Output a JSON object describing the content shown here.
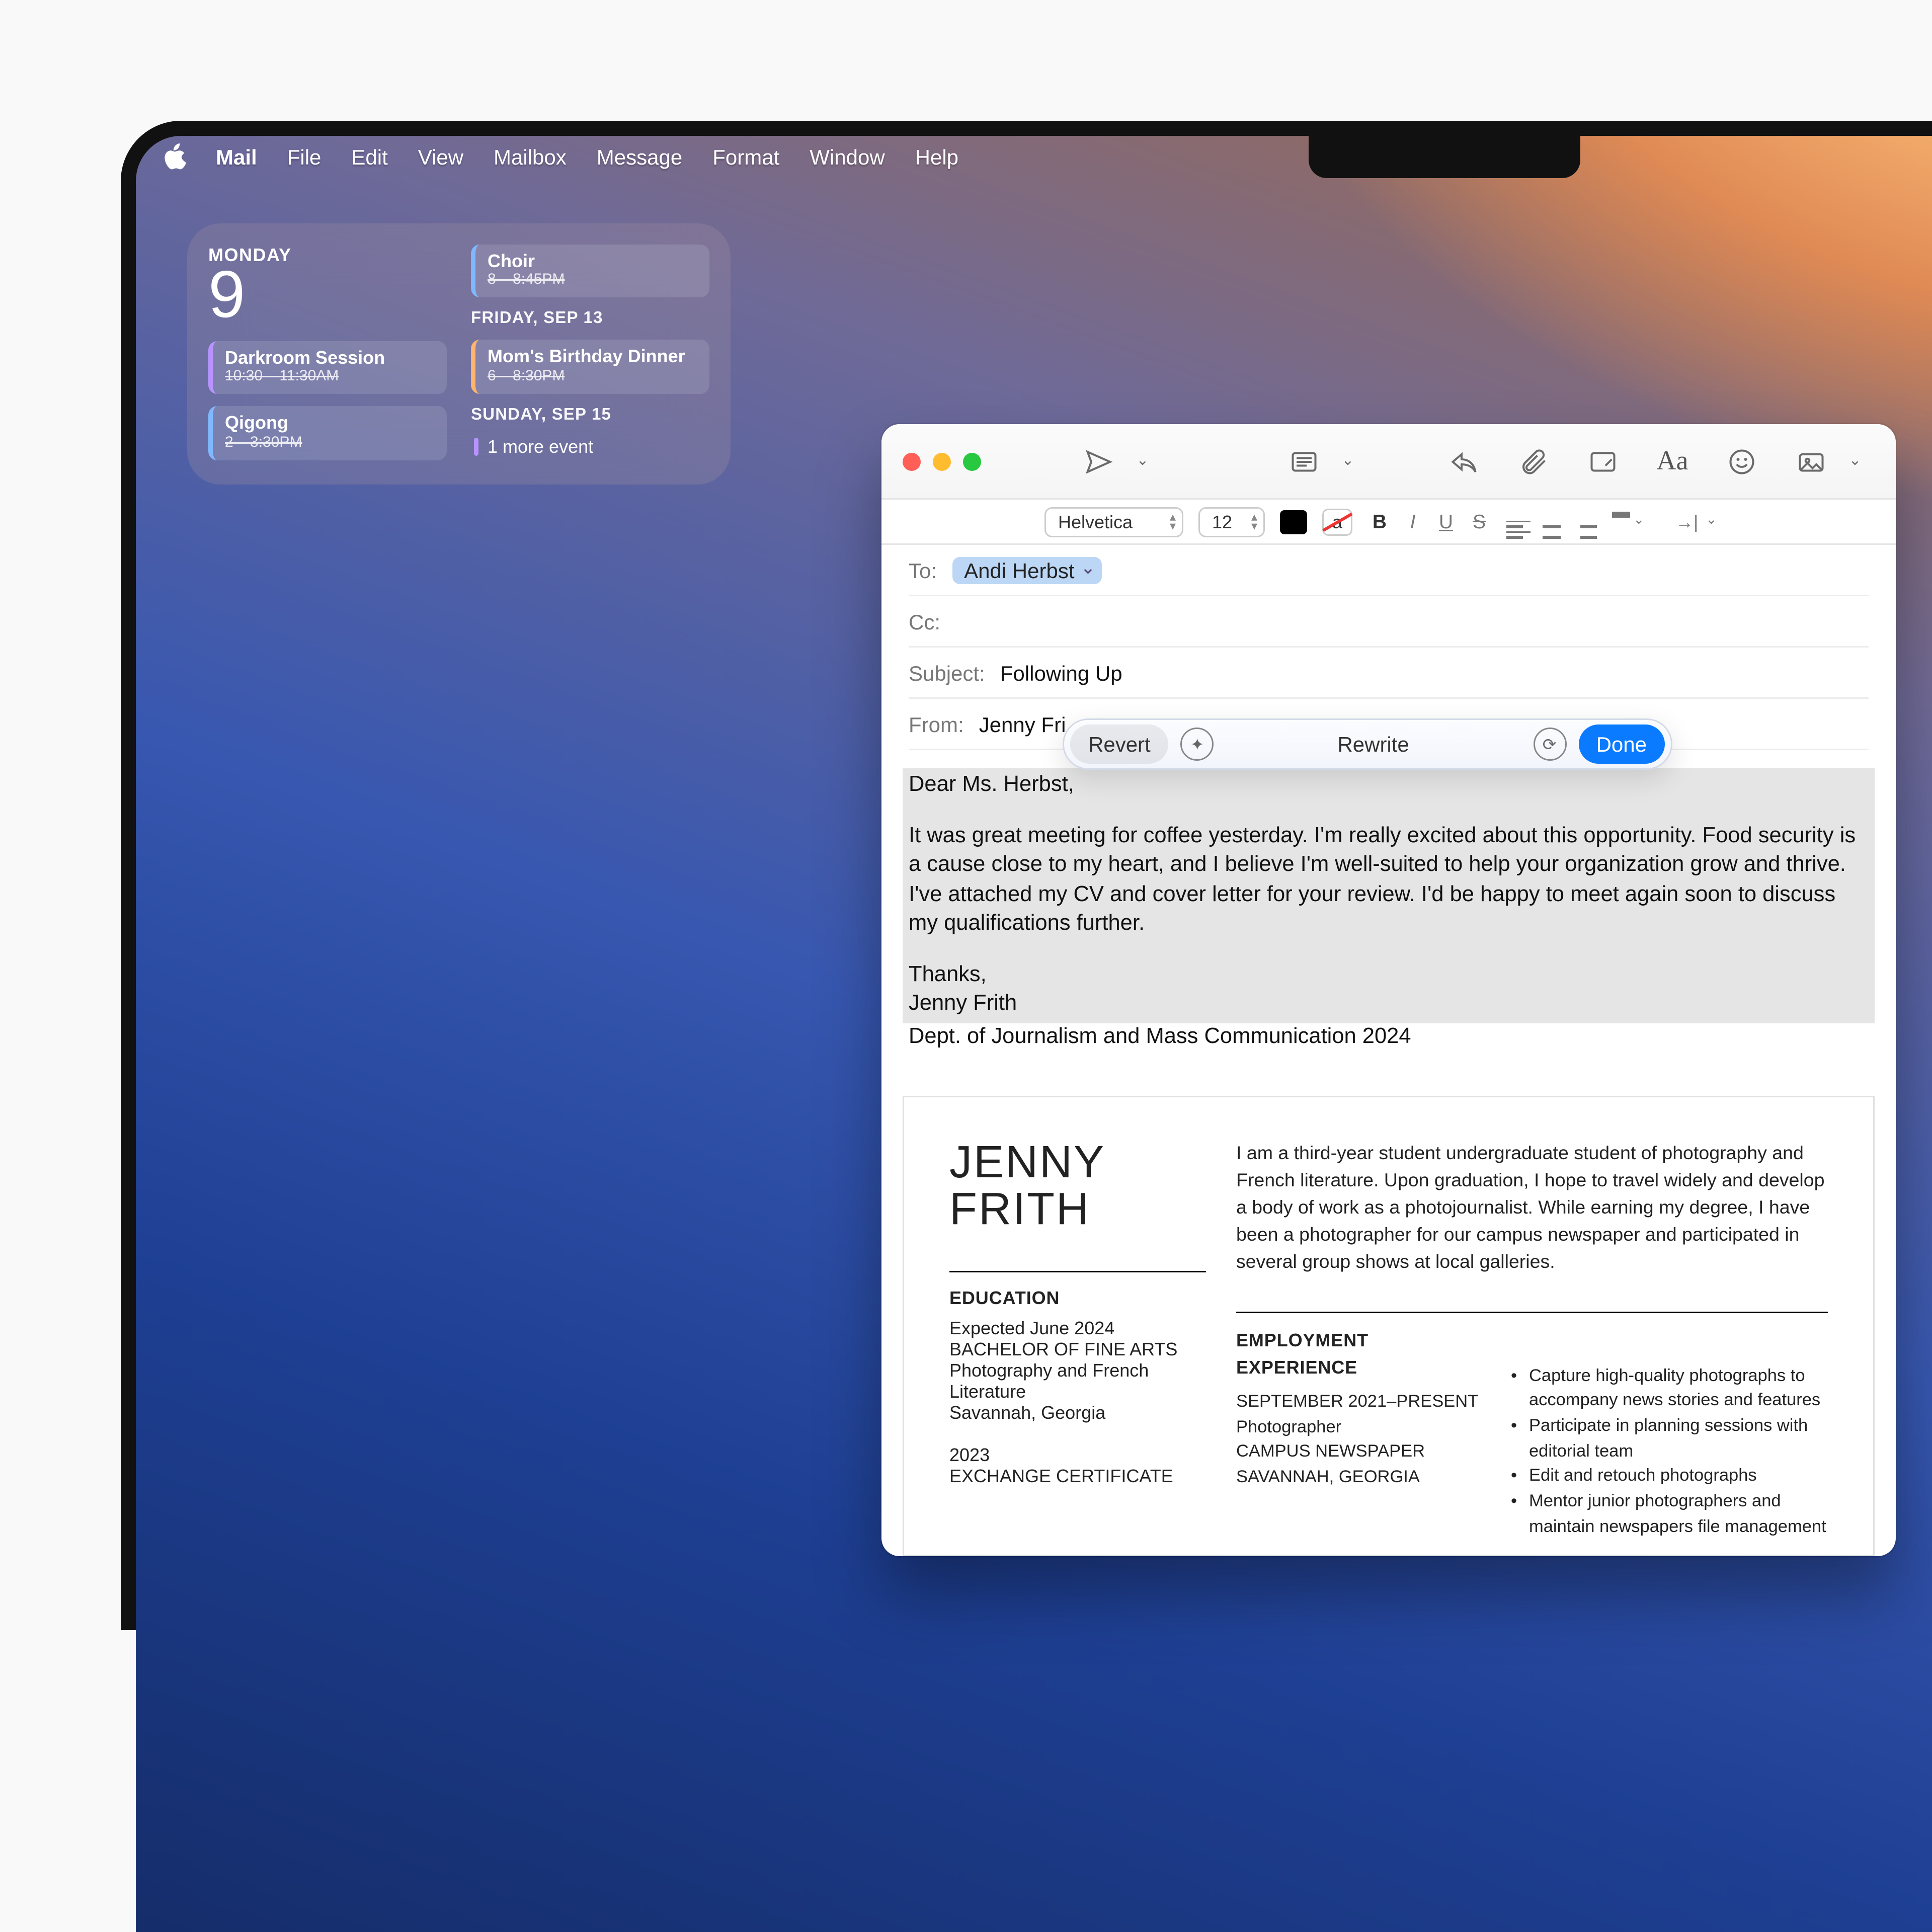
{
  "menubar": {
    "app": "Mail",
    "items": [
      "File",
      "Edit",
      "View",
      "Mailbox",
      "Message",
      "Format",
      "Window",
      "Help"
    ]
  },
  "widget": {
    "dow": "MONDAY",
    "day": "9",
    "left_events": [
      {
        "title": "Darkroom Session",
        "sub": "10:30 – 11:30AM",
        "c": "purple"
      },
      {
        "title": "Qigong",
        "sub": "2 – 3:30PM",
        "c": "blue"
      }
    ],
    "right": [
      {
        "header": null,
        "events": [
          {
            "title": "Choir",
            "sub": "8 – 8:45PM",
            "c": "blue"
          }
        ]
      },
      {
        "header": "FRIDAY, SEP 13",
        "events": [
          {
            "title": "Mom's Birthday Dinner",
            "sub": "6 – 8:30PM",
            "c": "orange"
          }
        ]
      },
      {
        "header": "SUNDAY, SEP 15",
        "more": "1 more event"
      }
    ]
  },
  "mail": {
    "font": "Helvetica",
    "size": "12",
    "to_label": "To:",
    "to_chip": "Andi Herbst",
    "cc_label": "Cc:",
    "subject_label": "Subject:",
    "subject": "Following Up",
    "from_label": "From:",
    "from": "Jenny Fri"
  },
  "pill": {
    "revert": "Revert",
    "center": "Rewrite",
    "done": "Done"
  },
  "body": {
    "l1": "Dear Ms. Herbst,",
    "l2": "It was great meeting for coffee yesterday. I'm really excited about this opportunity. Food security is a cause close to my heart, and I believe I'm well-suited to help your organization grow and thrive. I've attached my CV and cover letter for your review. I'd be happy to meet again soon to discuss my qualifications further.",
    "l3": "Thanks,",
    "l4": "Jenny Frith",
    "l5": "Dept. of Journalism and Mass Communication 2024"
  },
  "resume": {
    "name1": "JENNY",
    "name2": "FRITH",
    "intro": "I am a third-year student undergraduate student of photography and French literature. Upon graduation, I hope to travel widely and develop a body of work as a photojournalist. While earning my degree, I have been a photographer for our campus newspaper and participated in several group shows at local galleries.",
    "edu_h": "EDUCATION",
    "edu": [
      "Expected June 2024",
      "BACHELOR OF FINE ARTS",
      "Photography and French Literature",
      "Savannah, Georgia",
      "",
      "2023",
      "EXCHANGE CERTIFICATE"
    ],
    "emp_h": "EMPLOYMENT EXPERIENCE",
    "emp_left": [
      "SEPTEMBER 2021–PRESENT",
      "    Photographer",
      "CAMPUS NEWSPAPER",
      "SAVANNAH, GEORGIA"
    ],
    "emp_bullets": [
      "Capture high-quality photographs to accompany news stories and features",
      "Participate in planning sessions with editorial team",
      "Edit and retouch photographs",
      "Mentor junior photographers and maintain newspapers file management"
    ]
  }
}
